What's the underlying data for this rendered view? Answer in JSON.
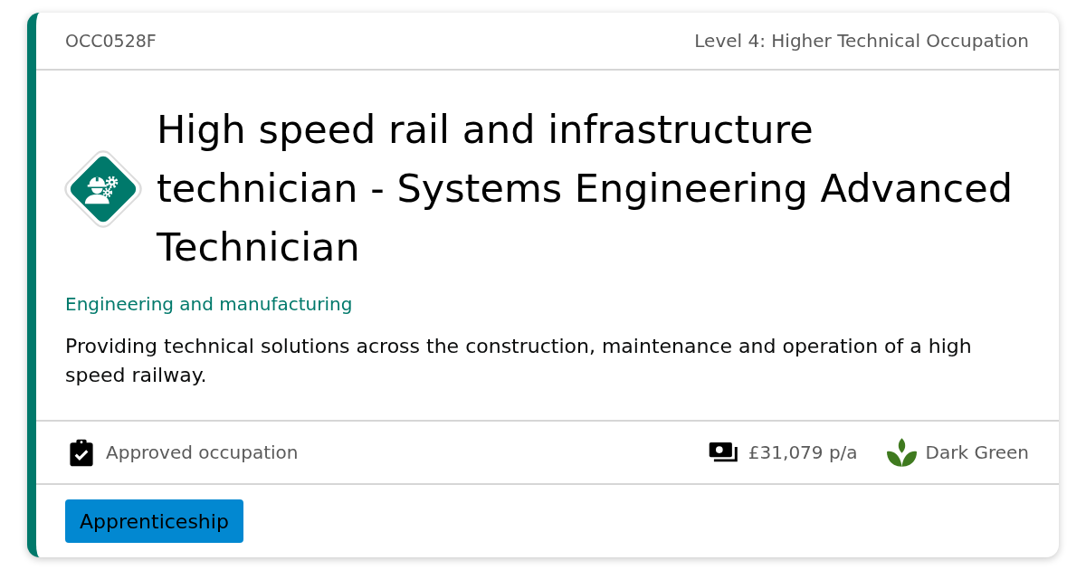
{
  "header": {
    "code": "OCC0528F",
    "level": "Level 4: Higher Technical Occupation"
  },
  "title": "High speed rail and infrastructure technician - Systems Engineering Advanced Technician",
  "sector": "Engineering and manufacturing",
  "summary": "Providing technical solutions across the construction, maintenance and operation of a high speed railway.",
  "footer": {
    "status": "Approved occupation",
    "details": [
      {
        "kind": "salary",
        "text": "£31,079 p/a"
      },
      {
        "kind": "rating",
        "text": "Dark Green"
      }
    ]
  },
  "tags": [
    "Apprenticeship"
  ]
}
